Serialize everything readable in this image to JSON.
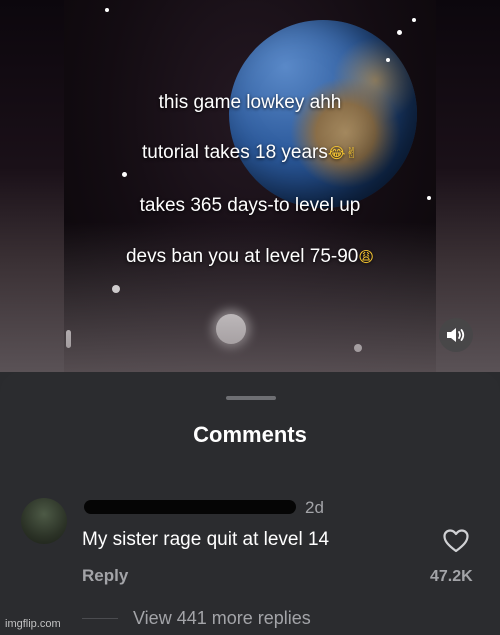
{
  "video": {
    "captions": [
      "this game lowkey ahh",
      "tutorial takes 18 years",
      "takes 365 days-to level up",
      "devs ban you at level 75-90"
    ],
    "caption_emojis": [
      "crying-laughing-face",
      "victory-hand",
      "weary-face"
    ],
    "volume_icon": "speaker-sound-icon"
  },
  "comments": {
    "title": "Comments",
    "comment": {
      "time": "2d",
      "text": "My sister rage quit at level 14",
      "reply_label": "Reply",
      "likes": "47.2K"
    },
    "view_replies": "View 441 more replies"
  },
  "watermark": "imgflip.com",
  "colors": {
    "sheet_background": "#2b2c2f",
    "muted_text": "#a3a4a8",
    "primary_text": "#ffffff"
  }
}
